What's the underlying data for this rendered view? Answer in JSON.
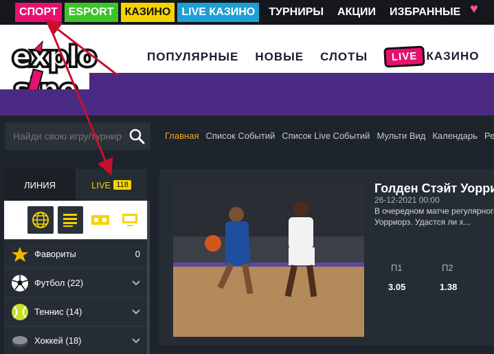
{
  "topnav": {
    "items": [
      "СПОРТ",
      "ESPORT",
      "КАЗИНО",
      "LIVE КАЗИНО",
      "ТУРНИРЫ",
      "АКЦИИ",
      "ИЗБРАННЫЕ"
    ]
  },
  "header": {
    "nav": [
      "ПОПУЛЯРНЫЕ",
      "НОВЫЕ",
      "СЛОТЫ"
    ],
    "live_badge": "LIVE",
    "live_casino": "КАЗИНО"
  },
  "search": {
    "placeholder": "Найди свою игру/турнир"
  },
  "subnav": [
    "Главная",
    "Список Событий",
    "Список Live Событий",
    "Мульти Вид",
    "Календарь",
    "Результаты"
  ],
  "sidebar": {
    "tab_line": "ЛИНИЯ",
    "tab_live": "LIVE",
    "live_count": "118",
    "rows": [
      {
        "label": "Фавориты",
        "value": "0"
      },
      {
        "label": "Футбол (22)"
      },
      {
        "label": "Теннис (14)"
      },
      {
        "label": "Хоккей (18)"
      }
    ]
  },
  "event": {
    "title": "Голден Стэйт Уорриорз",
    "date": "26-12-2021 00:00",
    "desc1": "В очередном матче регулярного",
    "desc2": "Уорриорз. Удастся ли х...",
    "odds_labels": [
      "П1",
      "П2"
    ],
    "odds_values": [
      "3.05",
      "1.38"
    ]
  },
  "colors": {
    "sport": "#e8106f",
    "esport": "#3cc42a",
    "casino": "#f5d300",
    "live_casino": "#1d9fd6",
    "purple_band": "#4b2a83",
    "active_link": "#f5a623",
    "arrow": "#c8102e"
  }
}
